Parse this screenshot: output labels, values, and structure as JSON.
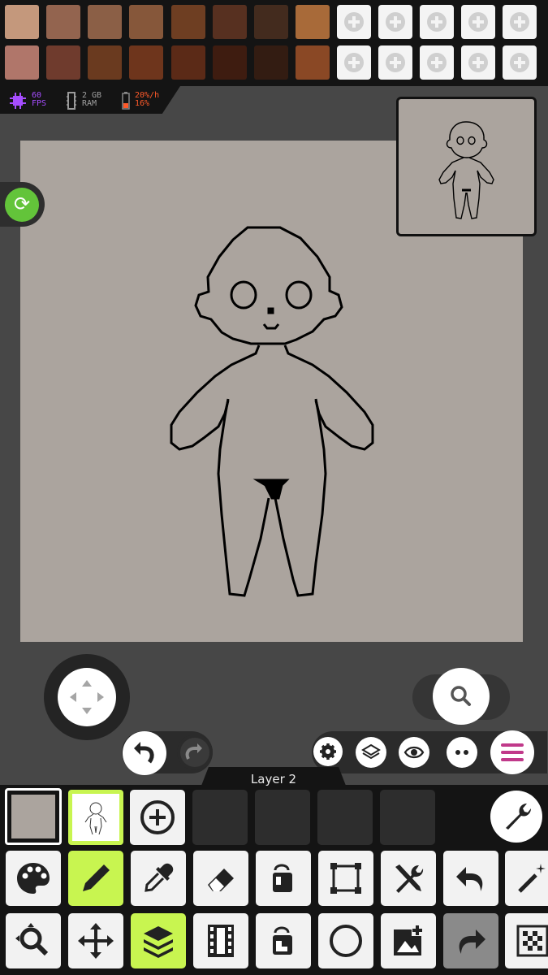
{
  "palette": {
    "swatches_row1": [
      "#c4987c",
      "#93644f",
      "#8b5f46",
      "#86573a",
      "#6e3e22",
      "#573020",
      "#432b1e",
      "#a86a39"
    ],
    "swatches_row2": [
      "#b0766a",
      "#6f3b2d",
      "#6a3a1f",
      "#6e351c",
      "#5b2a17",
      "#3e1c10",
      "#331c12",
      "#8a4825"
    ],
    "add_slot_icon": "add-circle-icon"
  },
  "stats": {
    "fps_value": "60",
    "fps_label": "FPS",
    "ram_value": "2 GB",
    "ram_label": "RAM",
    "battery_rate": "20%/h",
    "battery_level": "16%",
    "fps_color": "#a64dff",
    "battery_color": "#ff5a2a"
  },
  "layer": {
    "name": "Layer 2"
  },
  "colors": {
    "canvas_bg": "#aba49e",
    "accent_green": "#c8f550",
    "sync_green": "#63c43a",
    "menu_magenta": "#c0398a"
  },
  "tools_row1": [
    "palette-icon",
    "pencil-icon",
    "eyedropper-icon",
    "eraser-icon",
    "fill-bucket-icon",
    "select-rect-icon",
    "tools-icon",
    "undo-icon",
    "magic-wand-icon"
  ],
  "tools_row2": [
    "zoom-icon",
    "move-icon",
    "layers-icon",
    "film-strip-icon",
    "fill-pattern-icon",
    "circle-icon",
    "add-image-icon",
    "redo-icon",
    "grid-icon"
  ]
}
